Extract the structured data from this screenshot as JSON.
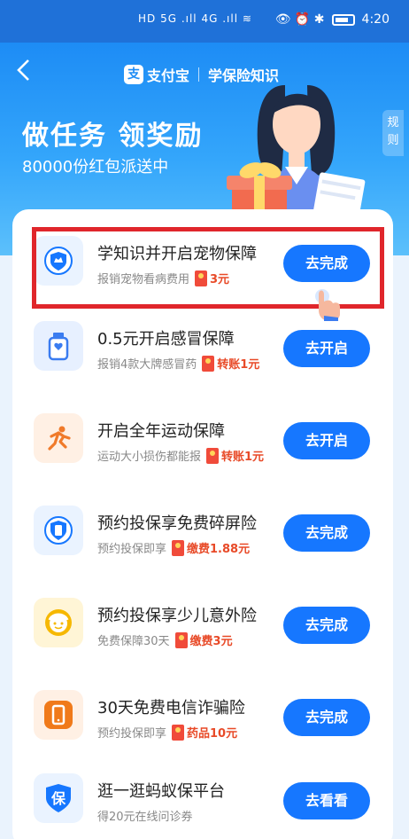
{
  "statusbar": {
    "network": "HD 5G .ıll 4G .ıll ≋",
    "right_icons": "👁 ⏰ ✱",
    "time": "4:20"
  },
  "header": {
    "brand": "支付宝",
    "page_title": "学保险知识",
    "rules": "规则"
  },
  "hero": {
    "title": "做任务 领奖励",
    "subtitle": "80000份红包派送中"
  },
  "tasks": [
    {
      "title": "学知识并开启宠物保障",
      "desc": "报销宠物看病费用",
      "reward": "3元",
      "button": "去完成",
      "icon": "pet-shield-icon",
      "color": "#1677ff",
      "bg": "#eaf3ff"
    },
    {
      "title": "0.5元开启感冒保障",
      "desc": "报销4款大牌感冒药",
      "reward": "转账1元",
      "button": "去开启",
      "icon": "medicine-bottle-icon",
      "color": "#3a7cf0",
      "bg": "#e7f0ff"
    },
    {
      "title": "开启全年运动保障",
      "desc": "运动大小损伤都能报",
      "reward": "转账1元",
      "button": "去开启",
      "icon": "running-icon",
      "color": "#f07a2a",
      "bg": "#fff0e4"
    },
    {
      "title": "预约投保享免费碎屏险",
      "desc": "预约投保即享",
      "reward": "缴费1.88元",
      "button": "去完成",
      "icon": "phone-shield-icon",
      "color": "#1677ff",
      "bg": "#eaf3ff"
    },
    {
      "title": "预约投保享少儿意外险",
      "desc": "免费保障30天",
      "reward": "缴费3元",
      "button": "去完成",
      "icon": "child-face-icon",
      "color": "#f6b800",
      "bg": "#fff5d6"
    },
    {
      "title": "30天免费电信诈骗险",
      "desc": "预约投保即享",
      "reward": "药品10元",
      "button": "去完成",
      "icon": "mobile-phone-icon",
      "color": "#f07a1a",
      "bg": "#fff0e4"
    },
    {
      "title": "逛一逛蚂蚁保平台",
      "desc": "得20元在线问诊券",
      "reward": "",
      "button": "去看看",
      "icon": "bao-shield-icon",
      "color": "#1677ff",
      "bg": "#eaf3ff",
      "icon_text": "保"
    }
  ]
}
